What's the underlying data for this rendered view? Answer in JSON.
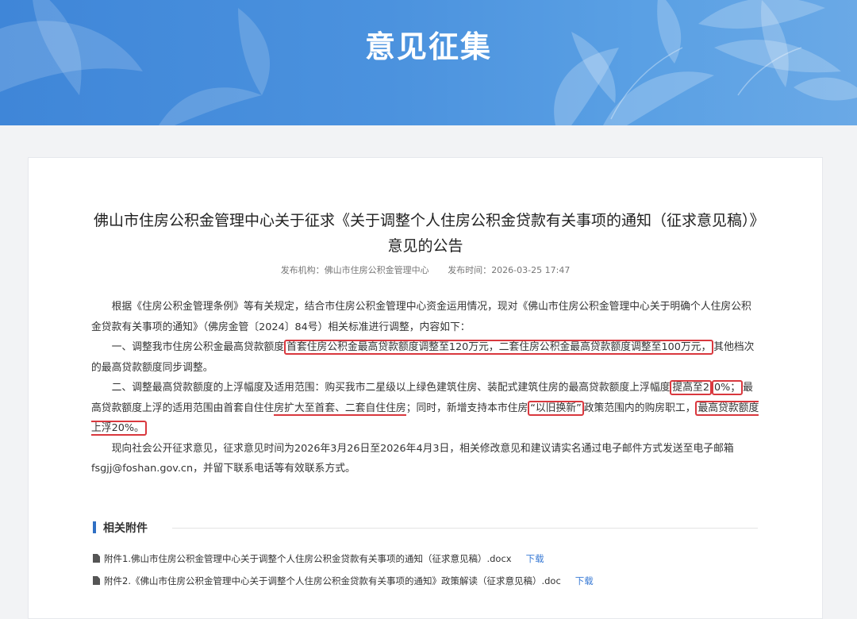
{
  "banner": {
    "title": "意见征集"
  },
  "article": {
    "title": "佛山市住房公积金管理中心关于征求《关于调整个人住房公积金贷款有关事项的通知（征求意见稿）》意见的公告",
    "meta": {
      "publisher_label": "发布机构：",
      "publisher": "佛山市住房公积金管理中心",
      "time_label": "发布时间：",
      "time": "2026-03-25 17:47"
    },
    "p1": "根据《住房公积金管理条例》等有关规定，结合市住房公积金管理中心资金运用情况，现对《佛山市住房公积金管理中心关于明确个人住房公积金贷款有关事项的通知》（佛房金管〔2024〕84号）相关标准进行调整，内容如下：",
    "p2": {
      "a": "一、调整我市住房公积金最高贷款额度",
      "hl": "首套住房公积金最高贷款额度调整至120万元，二套住房公积金最高贷款额度调整至100万元，",
      "b": "其他档次的最高贷款额度同步调整。"
    },
    "p3": {
      "a": "二、调整最高贷款额度的上浮幅度及适用范围：购买我市二星级以上绿色建筑住房、装配式建筑住房的最高贷款额度上浮幅度",
      "hl1": "提高至2",
      "hl1b": "0%；",
      "b": "最高贷款额度上浮的适用范围由首套自住住",
      "ul": "房扩大至首套、二套自住住房",
      "c": "；同时，新增支持本市住房",
      "hl2": "“以旧换新”",
      "d": "政策范围内的购房职工，",
      "hl3": "最高贷款额度上浮20%。"
    },
    "p4": "现向社会公开征求意见，征求意见时间为2026年3月26日至2026年4月3日，相关修改意见和建议请实名通过电子邮件方式发送至电子邮箱fsgjj@foshan.gov.cn，并留下联系电话等有效联系方式。"
  },
  "attachments": {
    "heading": "相关附件",
    "items": [
      {
        "name": "附件1.佛山市住房公积金管理中心关于调整个人住房公积金贷款有关事项的通知（征求意见稿）.docx",
        "action": "下载"
      },
      {
        "name": "附件2.《佛山市住房公积金管理中心关于调整个人住房公积金贷款有关事项的通知》政策解读（征求意见稿）.doc",
        "action": "下载"
      }
    ]
  },
  "colors": {
    "banner": "#4a90dc",
    "highlight": "#d9383e",
    "link": "#3a7bd5",
    "section_bar": "#2f6fc4"
  }
}
